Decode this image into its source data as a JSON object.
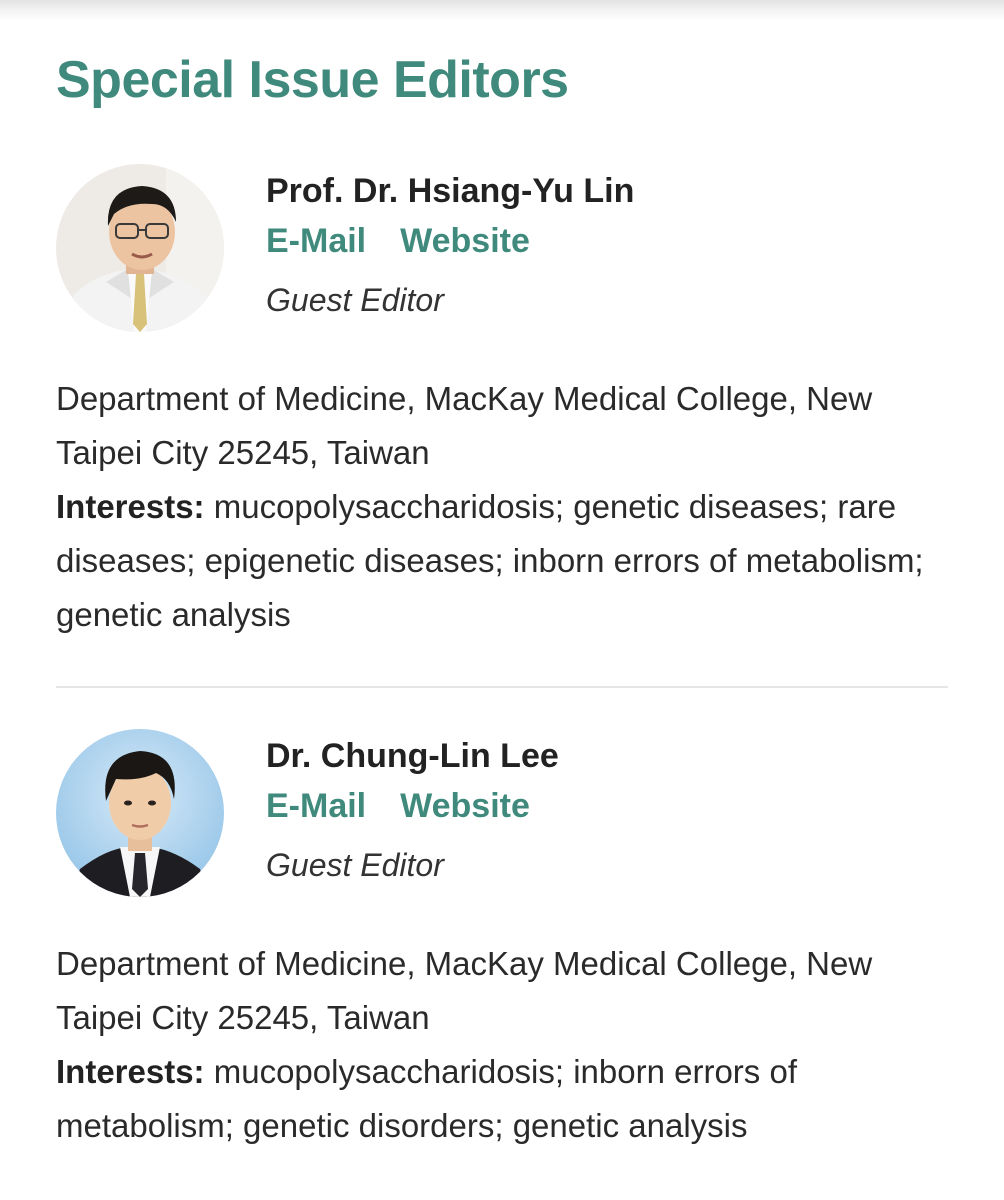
{
  "section": {
    "title": "Special Issue Editors"
  },
  "editors": [
    {
      "name": "Prof. Dr. Hsiang-Yu Lin",
      "email_label": "E-Mail",
      "website_label": "Website",
      "role": "Guest Editor",
      "affiliation": "Department of Medicine, MacKay Medical College, New Taipei City 25245, Taiwan",
      "interests_label": "Interests:",
      "interests": "mucopolysaccharidosis; genetic diseases; rare diseases; epigenetic diseases; inborn errors of metabolism; genetic analysis"
    },
    {
      "name": "Dr. Chung-Lin Lee",
      "email_label": "E-Mail",
      "website_label": "Website",
      "role": "Guest Editor",
      "affiliation": "Department of Medicine, MacKay Medical College, New Taipei City 25245, Taiwan",
      "interests_label": "Interests:",
      "interests": "mucopolysaccharidosis; inborn errors of metabolism; genetic disorders; genetic analysis"
    }
  ],
  "colors": {
    "accent": "#3f8a7c",
    "text": "#222222",
    "divider": "#e6e6e6"
  },
  "icons": {
    "editor_photo": "portrait-photo"
  }
}
